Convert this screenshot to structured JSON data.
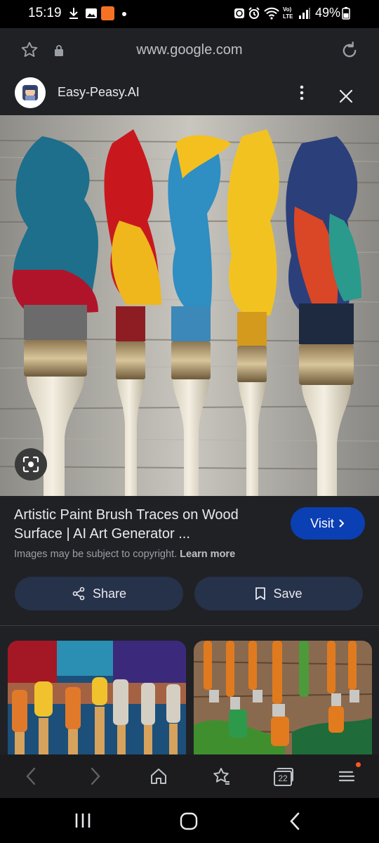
{
  "status_bar": {
    "time": "15:19",
    "battery": "49%"
  },
  "address_bar": {
    "url": "www.google.com"
  },
  "source": {
    "name": "Easy-Peasy.AI"
  },
  "result": {
    "title": "Artistic Paint Brush Traces on Wood Surface | AI Art Generator ...",
    "visit_label": "Visit",
    "copyright_text": "Images may be subject to copyright.",
    "learn_more": "Learn more",
    "share_label": "Share",
    "save_label": "Save"
  },
  "bottom_nav": {
    "tabs_count": "22"
  },
  "icons": {
    "status": [
      "download-icon",
      "gallery-icon",
      "temu-app-icon",
      "dot-icon",
      "alarm-app-icon",
      "alarm-icon",
      "wifi-icon",
      "volte-icon",
      "signal-icon",
      "battery-icon"
    ],
    "address": [
      "star-icon",
      "lock-icon",
      "reload-icon"
    ],
    "source": [
      "source-avatar",
      "more-vert-icon",
      "close-icon"
    ],
    "image": [
      "lens-icon"
    ],
    "nav": [
      "back-icon",
      "forward-icon",
      "home-icon",
      "bookmarks-icon",
      "tabs-icon",
      "menu-icon"
    ],
    "system": [
      "recents-icon",
      "home-pill-icon",
      "system-back-icon"
    ]
  },
  "colors": {
    "accent_visit": "#0b3fb4",
    "pill_bg": "#26314a",
    "notification_dot": "#ff5722"
  }
}
